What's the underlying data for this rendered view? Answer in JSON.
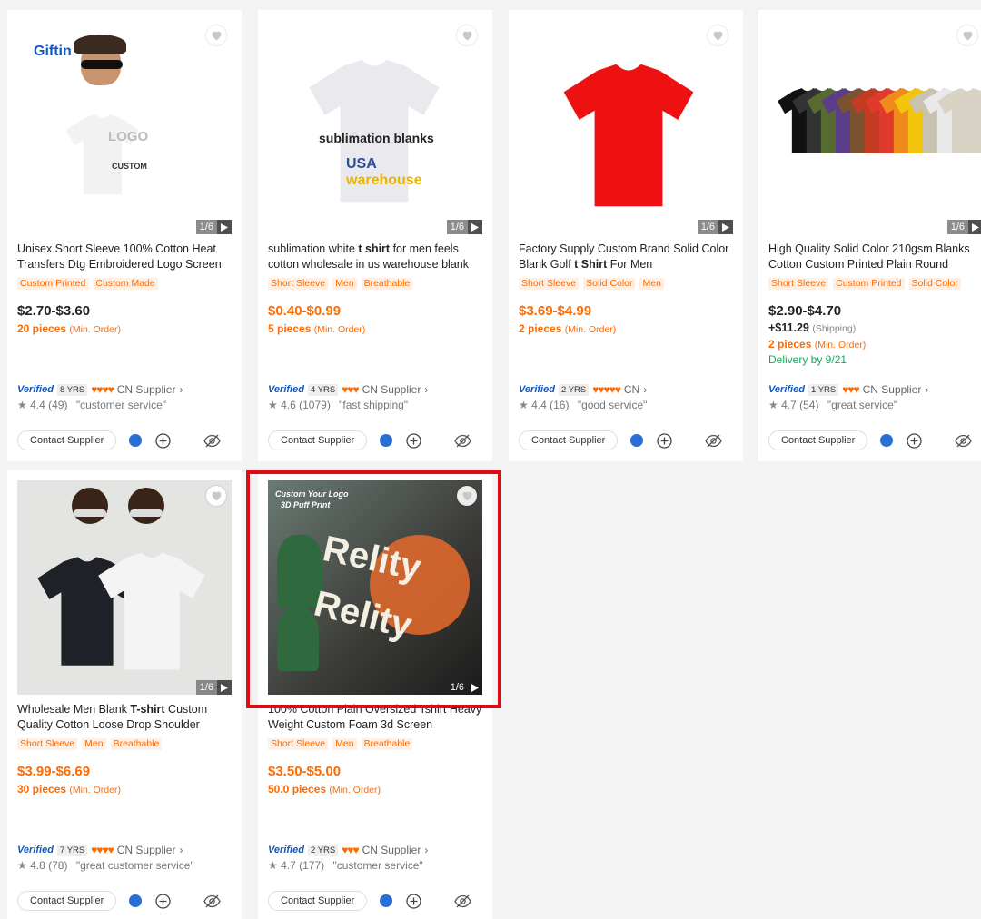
{
  "products": [
    {
      "title_pre": "Unisex Short Sleeve 100% Cotton Heat Transfers Dtg Embroidered Logo Screen",
      "title_bold": "",
      "title_post": "",
      "tags": [
        "Custom Printed",
        "Custom Made"
      ],
      "price": "$2.70-$3.60",
      "price_color": "#222222",
      "moq_qty": "20 pieces",
      "moq_label": "(Min. Order)",
      "shipping": "",
      "shipping_label": "",
      "delivery": "",
      "verified": "Verified",
      "years": "8 YRS",
      "hearts": 4,
      "supplier": "CN  Supplier",
      "rating": "4.4 (49)",
      "review": "\"customer service\"",
      "contact_label": "Contact Supplier",
      "image_logo": "Giftin",
      "image_count": "1/6",
      "image_texts": [
        "LOGO",
        "CUSTOM"
      ]
    },
    {
      "title_pre": "sublimation white ",
      "title_bold": "t shirt",
      "title_post": " for men feels cotton wholesale in us warehouse blank",
      "tags": [
        "Short Sleeve",
        "Men",
        "Breathable"
      ],
      "price": "$0.40-$0.99",
      "price_color": "#ff6a00",
      "moq_qty": "5 pieces",
      "moq_label": "(Min. Order)",
      "shipping": "",
      "shipping_label": "",
      "delivery": "",
      "verified": "Verified",
      "years": "4 YRS",
      "hearts": 3,
      "supplier": "CN  Supplier",
      "rating": "4.6 (1079)",
      "review": "\"fast shipping\"",
      "contact_label": "Contact Supplier",
      "image_count": "1/6",
      "image_texts": [
        "sublimation blanks",
        "USA",
        "warehouse"
      ]
    },
    {
      "title_pre": "Factory Supply Custom Brand Solid Color Blank Golf ",
      "title_bold": "t Shirt",
      "title_post": " For Men",
      "tags": [
        "Short Sleeve",
        "Solid Color",
        "Men"
      ],
      "price": "$3.69-$4.99",
      "price_color": "#ff6a00",
      "moq_qty": "2 pieces",
      "moq_label": "(Min. Order)",
      "shipping": "",
      "shipping_label": "",
      "delivery": "",
      "verified": "Verified",
      "years": "2 YRS",
      "hearts": 5,
      "supplier": "CN",
      "rating": "4.4 (16)",
      "review": "\"good service\"",
      "contact_label": "Contact Supplier",
      "image_count": "1/6"
    },
    {
      "title_pre": "High Quality Solid Color 210gsm Blanks Cotton Custom Printed Plain Round",
      "title_bold": "",
      "title_post": "",
      "tags": [
        "Short Sleeve",
        "Custom Printed",
        "Solid Color"
      ],
      "price": "$2.90-$4.70",
      "price_color": "#222222",
      "moq_qty": "2 pieces",
      "moq_label": "(Min. Order)",
      "shipping": "+$11.29",
      "shipping_label": "(Shipping)",
      "delivery": "Delivery by 9/21",
      "verified": "Verified",
      "years": "1 YRS",
      "hearts": 3,
      "supplier": "CN  Supplier",
      "rating": "4.7 (54)",
      "review": "\"great service\"",
      "contact_label": "Contact Supplier",
      "image_count": "1/6"
    },
    {
      "title_pre": "Wholesale Men Blank ",
      "title_bold": "T-shirt",
      "title_post": " Custom Quality Cotton Loose Drop Shoulder",
      "tags": [
        "Short Sleeve",
        "Men",
        "Breathable"
      ],
      "price": "$3.99-$6.69",
      "price_color": "#ff6a00",
      "moq_qty": "30 pieces",
      "moq_label": "(Min. Order)",
      "shipping": "",
      "shipping_label": "",
      "delivery": "",
      "verified": "Verified",
      "years": "7 YRS",
      "hearts": 4,
      "supplier": "CN  Supplier",
      "rating": "4.8 (78)",
      "review": "\"great customer service\"",
      "contact_label": "Contact Supplier",
      "image_count": "1/6"
    },
    {
      "title_pre": "100% Cotton Plain Oversized Tshirt Heavy Weight Custom Foam 3d Screen",
      "title_bold": "",
      "title_post": "",
      "tags": [
        "Short Sleeve",
        "Men",
        "Breathable"
      ],
      "price": "$3.50-$5.00",
      "price_color": "#ff6a00",
      "moq_qty": "50.0 pieces",
      "moq_label": "(Min. Order)",
      "shipping": "",
      "shipping_label": "",
      "delivery": "",
      "verified": "Verified",
      "years": "2 YRS",
      "hearts": 3,
      "supplier": "CN  Supplier",
      "rating": "4.7 (177)",
      "review": "\"customer service\"",
      "contact_label": "Contact Supplier",
      "image_count": "1/6",
      "image_texts": [
        "Custom Your Logo",
        "3D Puff Print",
        "Relity",
        "Relity"
      ]
    }
  ],
  "colors": {
    "accent": "#ff6a00",
    "verified": "#1057c5",
    "highlight": "#e00a16",
    "delivery": "#11a85b",
    "chat": "#2b6fd6"
  },
  "icons": [
    "heart-icon",
    "play-icon",
    "chat-icon",
    "add-icon",
    "hide-icon",
    "star-icon",
    "chevron-right-icon"
  ]
}
